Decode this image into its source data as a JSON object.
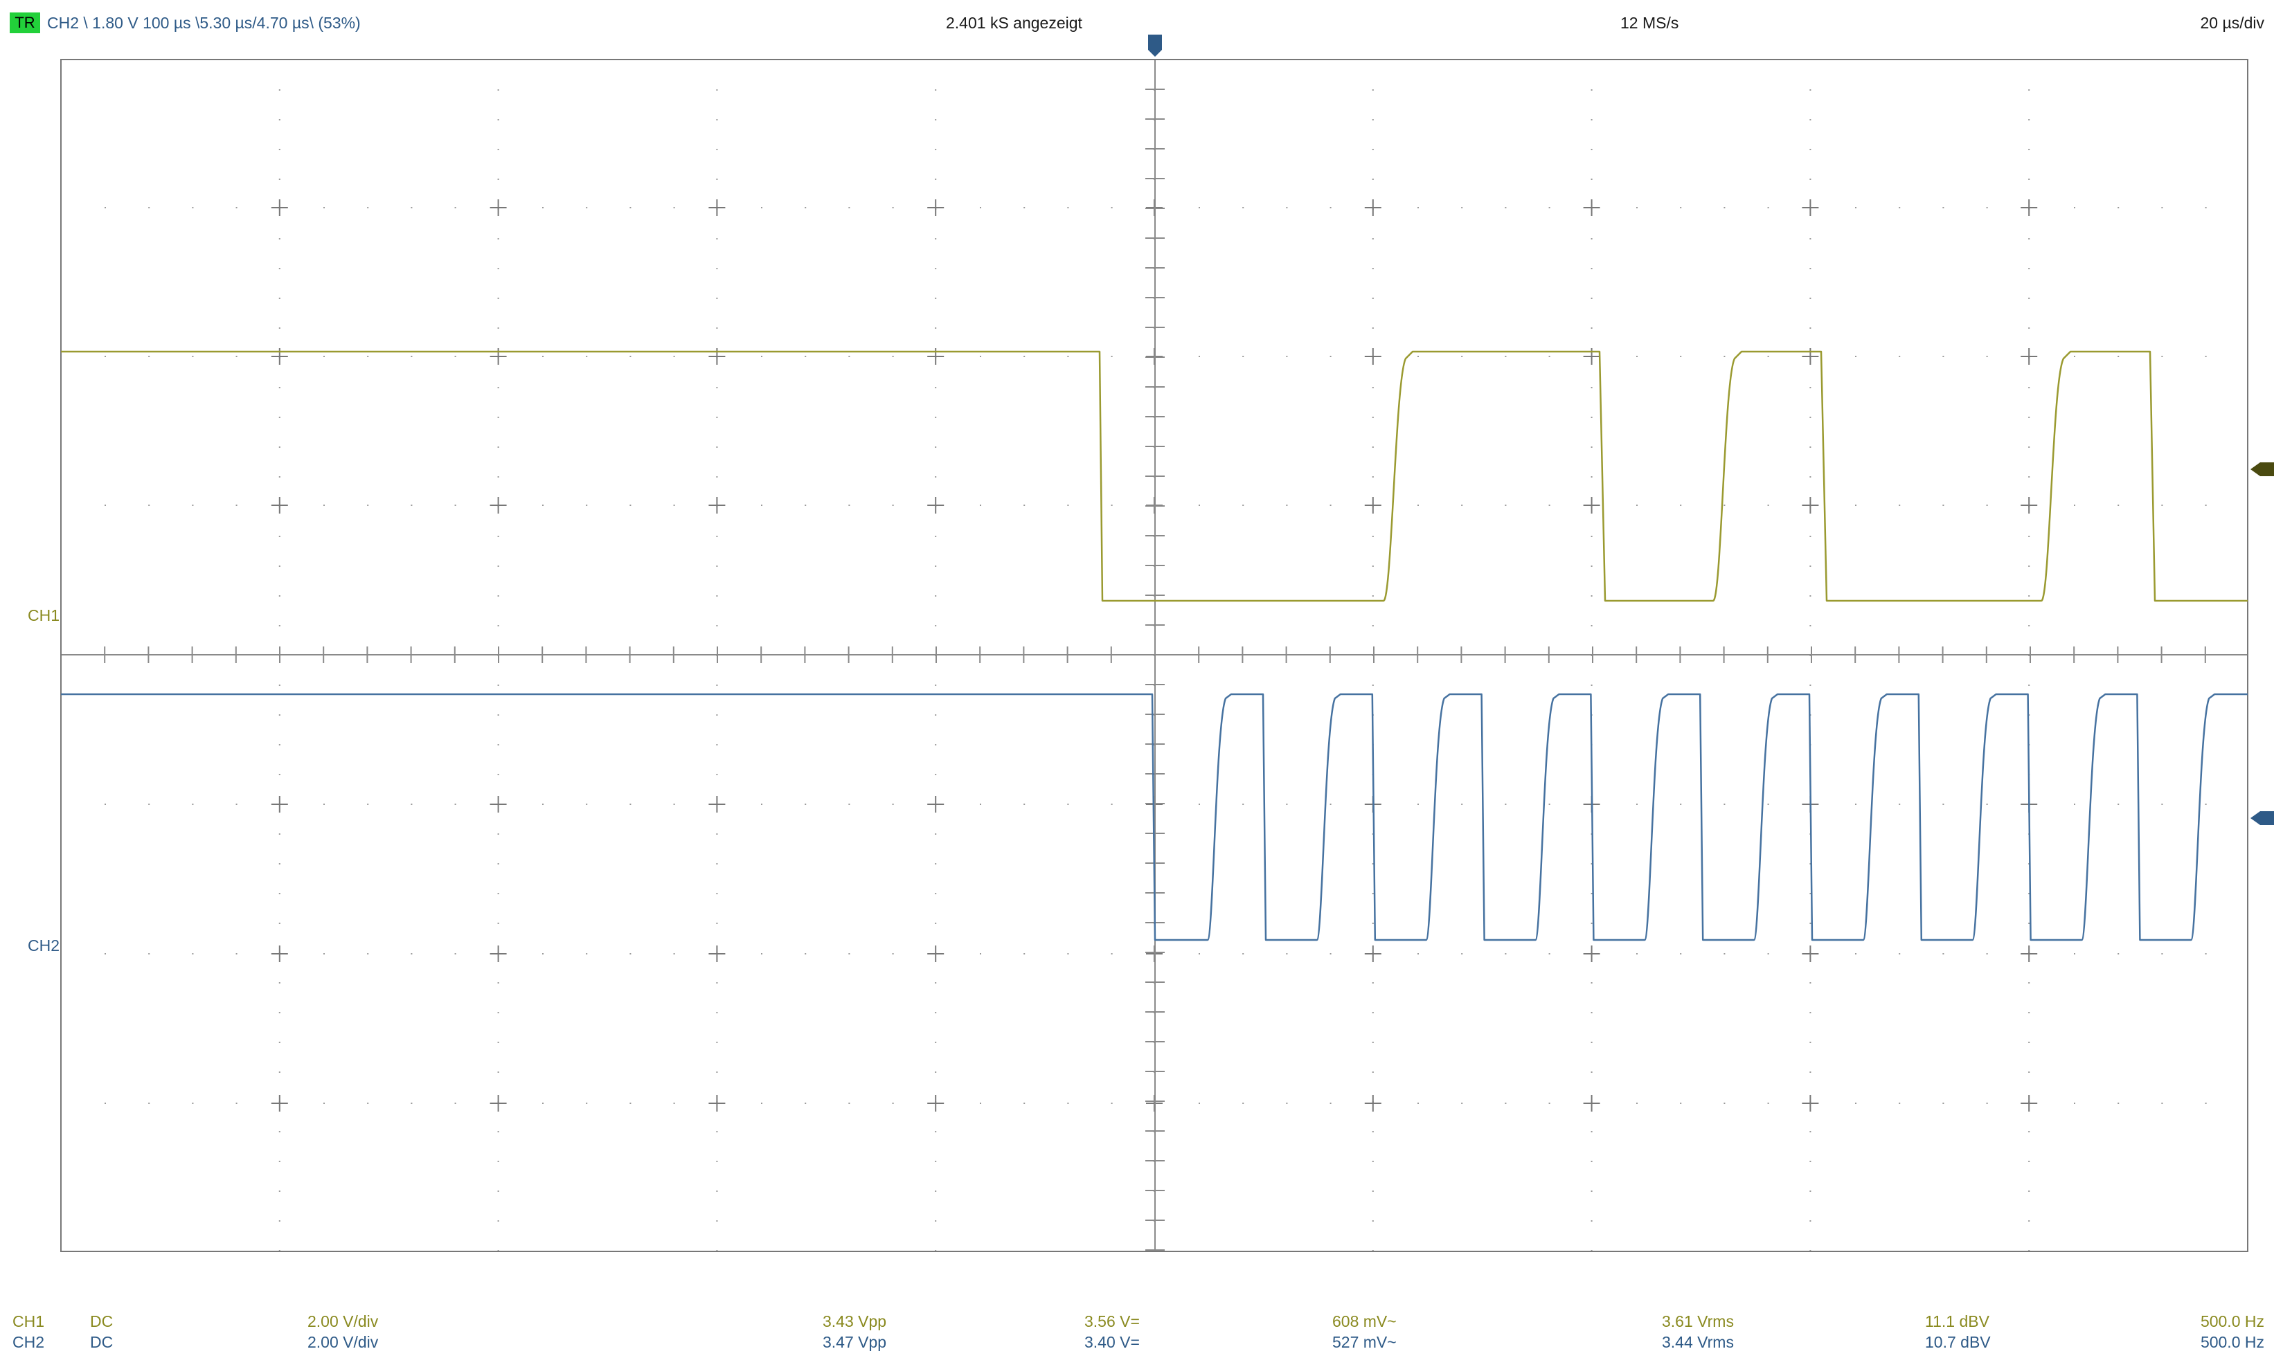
{
  "header": {
    "trigger_badge": "TR",
    "trigger_info": "CH2  \\  1.80 V  100 µs \\5.30 µs/4.70 µs\\ (53%)",
    "samples_shown": "2.401 kS angezeigt",
    "sample_rate": "12 MS/s",
    "timebase": "20 µs/div"
  },
  "channel_labels": {
    "ch1": "CH1",
    "ch2": "CH2"
  },
  "colors": {
    "ch1": "#8a8a20",
    "ch2": "#2e5a87",
    "grid": "#777777",
    "border": "#666666",
    "trigger_badge": "#22d03a"
  },
  "measurements": [
    {
      "channel": "CH1",
      "coupling": "DC",
      "scale": "2.00 V/div",
      "vpp": "3.43 Vpp",
      "vdc": "3.56 V=",
      "vac": "608 mV~",
      "vrms": "3.61 Vrms",
      "dbv": "11.1 dBV",
      "freq": "500.0 Hz"
    },
    {
      "channel": "CH2",
      "coupling": "DC",
      "scale": "2.00 V/div",
      "vpp": "3.47 Vpp",
      "vdc": "3.40 V=",
      "vac": "527 mV~",
      "vrms": "3.44 Vrms",
      "dbv": "10.7 dBV",
      "freq": "500.0 Hz"
    }
  ],
  "icons": {
    "trigger_position": "trigger-position-marker-icon",
    "ch1_level": "ch1-level-marker-icon",
    "ch2_level": "ch2-level-marker-icon"
  }
}
